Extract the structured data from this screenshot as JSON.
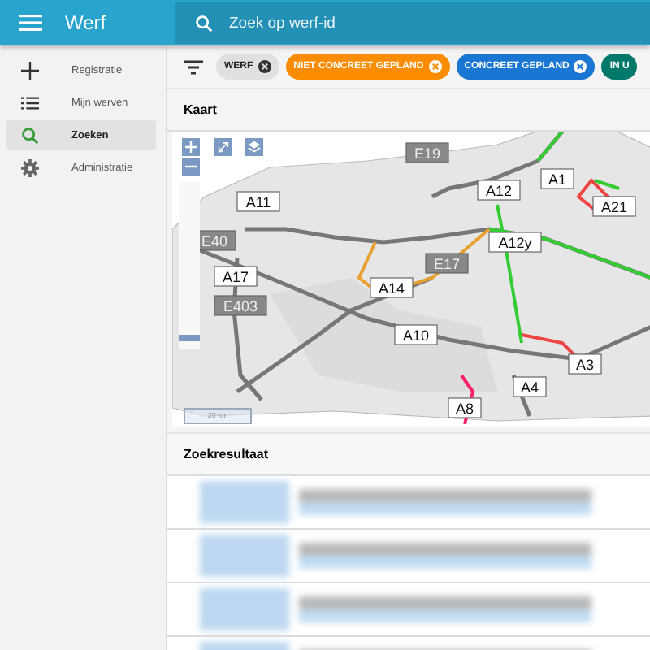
{
  "app_bar": {
    "title": "Werf",
    "search": {
      "placeholder": "Zoek op werf-id"
    }
  },
  "sidebar": {
    "items": [
      {
        "label": "Registratie",
        "kind": "plus",
        "selected": false
      },
      {
        "label": "Mijn werven",
        "kind": "list",
        "selected": false
      },
      {
        "label": "Zoeken",
        "kind": "search",
        "selected": true
      },
      {
        "label": "Administratie",
        "kind": "gear",
        "selected": false
      }
    ]
  },
  "filters": [
    {
      "label": "WERF",
      "color": "#e0e0e0"
    },
    {
      "label": "NIET CONCREET GEPLAND",
      "color": "#fb8c00"
    },
    {
      "label": "CONCREET GEPLAND",
      "color": "#1976d2"
    },
    {
      "label": "IN U",
      "color": "#00796b"
    }
  ],
  "map_card": {
    "title": "Kaart",
    "zoom_slider": {
      "level": 0.05
    },
    "scale": "20 km",
    "road_labels": [
      {
        "text": "E19",
        "kind": "e"
      },
      {
        "text": "A12",
        "kind": "a"
      },
      {
        "text": "A1",
        "kind": "a"
      },
      {
        "text": "A21",
        "kind": "a"
      },
      {
        "text": "A11",
        "kind": "a"
      },
      {
        "text": "E40",
        "kind": "e"
      },
      {
        "text": "A12y",
        "kind": "a"
      },
      {
        "text": "E17",
        "kind": "e"
      },
      {
        "text": "A17",
        "kind": "a"
      },
      {
        "text": "A14",
        "kind": "a"
      },
      {
        "text": "E403",
        "kind": "e"
      },
      {
        "text": "A10",
        "kind": "a"
      },
      {
        "text": "A3",
        "kind": "a"
      },
      {
        "text": "A4",
        "kind": "a"
      },
      {
        "text": "A8",
        "kind": "a"
      }
    ]
  },
  "results": {
    "title": "Zoekresultaat"
  }
}
